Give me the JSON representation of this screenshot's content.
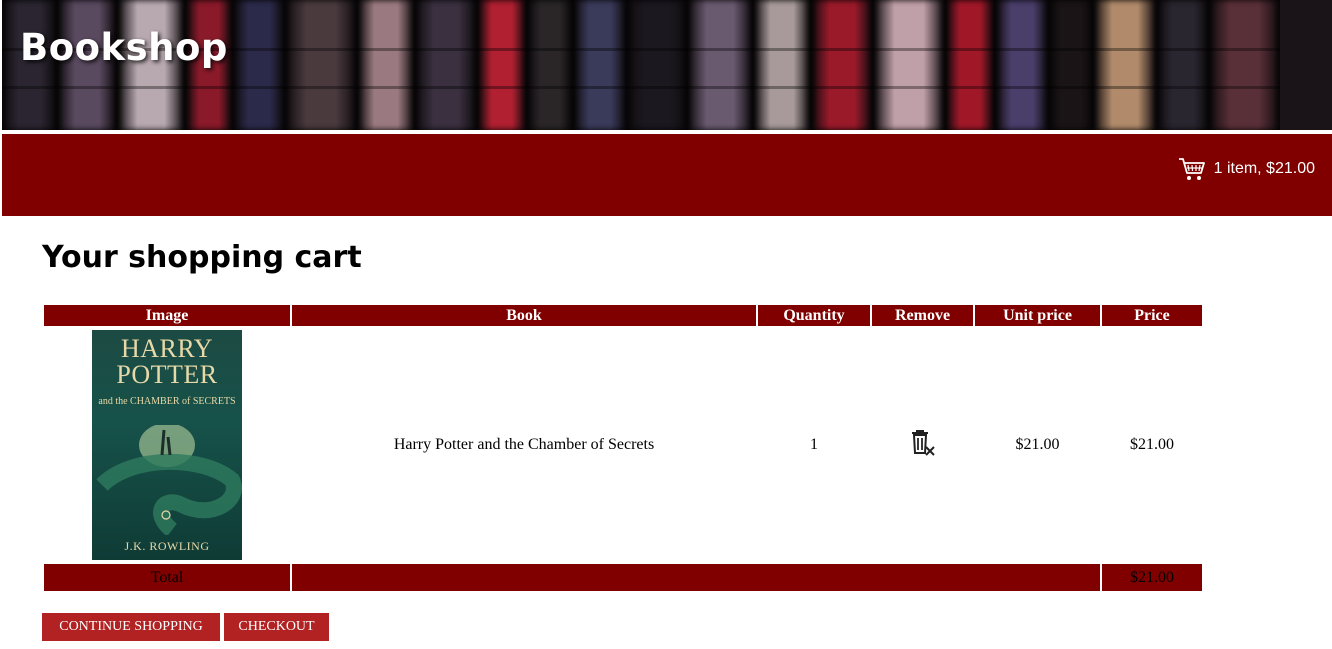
{
  "header": {
    "site_title": "Bookshop",
    "cart_summary": "1 item, $21.00",
    "banner_colors": [
      "#2a2530",
      "#5a4a60",
      "#b8a9b0",
      "#8a1a2a",
      "#2c2a4a",
      "#4a3a3e",
      "#9a7a80",
      "#3a3040",
      "#b02030",
      "#2a2628",
      "#3a3a5a",
      "#1c1820",
      "#6a5a70",
      "#a89a9a",
      "#9a1a2a",
      "#c0a0a8",
      "#a01828",
      "#4a3e6a",
      "#1a1416",
      "#b08a6a",
      "#2a2630",
      "#5a3038"
    ]
  },
  "main": {
    "heading": "Your shopping cart",
    "table": {
      "columns": [
        "Image",
        "Book",
        "Quantity",
        "Remove",
        "Unit price",
        "Price"
      ],
      "rows": [
        {
          "cover": {
            "title_line1": "HARRY",
            "title_line2": "POTTER",
            "subtitle": "and the CHAMBER of SECRETS",
            "author": "J.K. ROWLING"
          },
          "book": "Harry Potter and the Chamber of Secrets",
          "quantity": "1",
          "remove_icon": "trash-remove-icon",
          "unit_price": "$21.00",
          "price": "$21.00"
        }
      ],
      "total_label": "Total",
      "total_value": "$21.00"
    },
    "buttons": {
      "continue_label": "CONTINUE SHOPPING",
      "checkout_label": "CHECKOUT"
    }
  },
  "colors": {
    "brand": "#800000",
    "button": "#b22222"
  }
}
